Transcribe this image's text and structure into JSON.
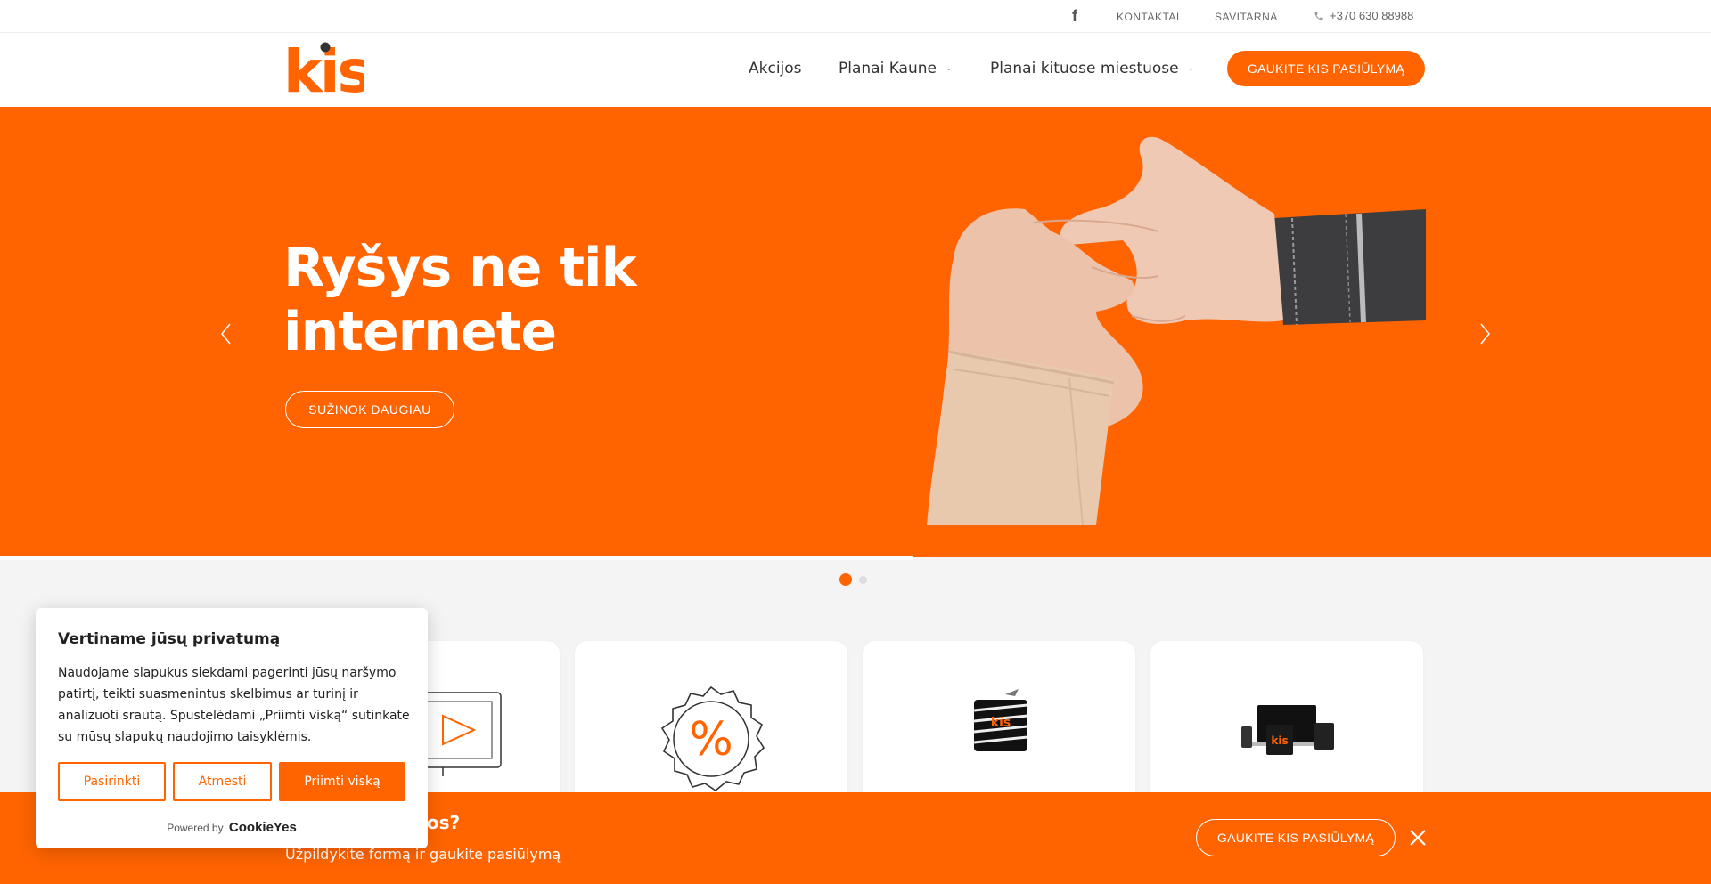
{
  "topbar": {
    "facebook_icon": "f",
    "contacts": "KONTAKTAI",
    "selfservice": "SAVITARNA",
    "phone": "+370 630 88988"
  },
  "header": {
    "logo_text": "kis",
    "nav": [
      {
        "label": "Akcijos"
      },
      {
        "label": "Planai Kaune"
      },
      {
        "label": "Planai kituose miestuose"
      }
    ],
    "cta": "GAUKITE KIS PASIŪLYMĄ"
  },
  "hero": {
    "title_line1": "Ryšys ne tik",
    "title_line2": "internete",
    "button": "SUŽINOK DAUGIAU"
  },
  "slider": {
    "slide_count": 2,
    "active_index": 0
  },
  "sticky": {
    "title_partial": "laugos?",
    "subtitle": "Užpildykite formą ir gaukite pasiūlymą",
    "button": "GAUKITE KIS PASIŪLYMĄ"
  },
  "cookie": {
    "title": "Vertiname jūsų privatumą",
    "text": "Naudojame slapukus siekdami pagerinti jūsų naršymo patirtį, teikti suasmenintus skelbimus ar turinį ir analizuoti srautą. Spustelėdami „Priimti viską“ sutinkate su mūsų slapukų naudojimo taisyklėmis.",
    "btn_customize": "Pasirinkti",
    "btn_reject": "Atmesti",
    "btn_accept": "Priimti viską",
    "powered_by": "Powered by",
    "brand": "CookieYes"
  },
  "colors": {
    "brand_orange": "#ff6400",
    "text_dark": "#212121"
  },
  "icons": [
    "facebook-icon",
    "phone-icon",
    "chevron-left-icon",
    "chevron-right-icon",
    "close-icon",
    "tv-play-icon",
    "percent-badge-icon"
  ]
}
